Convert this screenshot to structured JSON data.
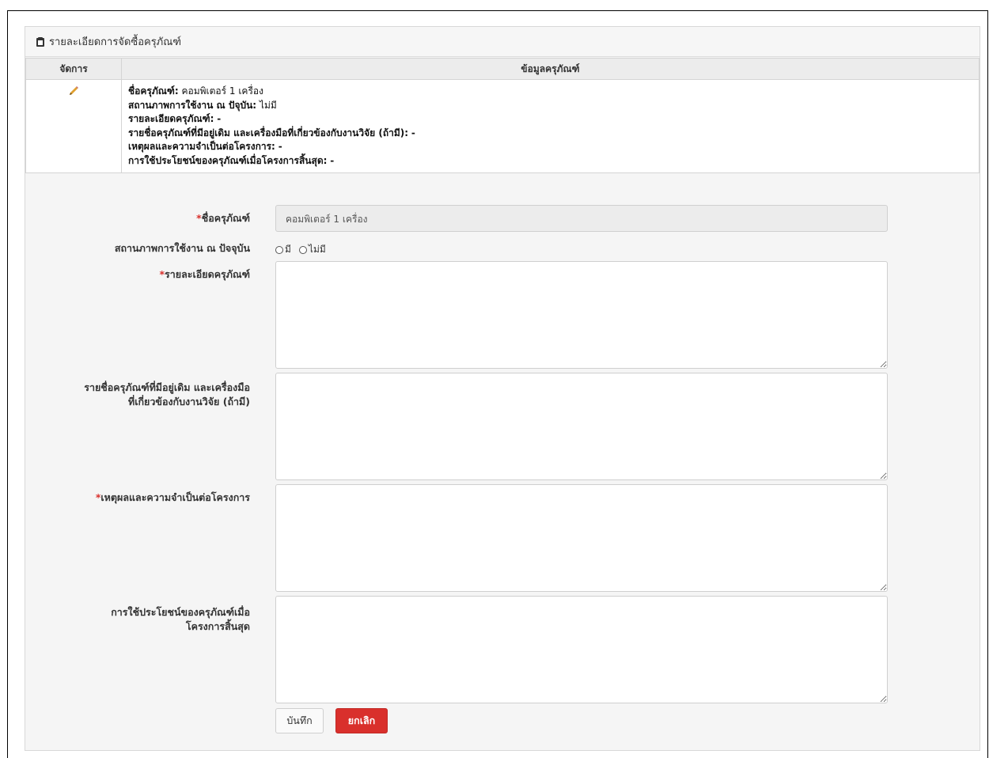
{
  "panel": {
    "title": "รายละเอียดการจัดซื้อครุภัณฑ์",
    "icon": "clipboard-icon"
  },
  "table": {
    "headers": {
      "action": "จัดการ",
      "info": "ข้อมูลครุภัณฑ์"
    },
    "row": {
      "edit_icon": "pencil-icon",
      "fields": [
        {
          "label": "ชื่อครุภัณฑ์:",
          "value": "คอมพิเตอร์ 1 เครื่อง"
        },
        {
          "label": "สถานภาพการใช้งาน ณ ปัจุบัน:",
          "value": "ไม่มี"
        },
        {
          "label": "รายละเอียดครุภัณฑ์:",
          "value": "-"
        },
        {
          "label": "รายชื่อครุภัณฑ์ที่มีอยู่เดิม และเครื่องมือที่เกี่ยวข้องกับงานวิจัย (ถ้ามี):",
          "value": "-"
        },
        {
          "label": "เหตุผลและความจำเป็นต่อโครงการ:",
          "value": "-"
        },
        {
          "label": "การใช้ประโยชน์ของครุภัณฑ์เมื่อโครงการสิ้นสุด:",
          "value": "-"
        }
      ]
    }
  },
  "form": {
    "required_mark": "*",
    "name": {
      "label": "ชื่อครุภัณฑ์",
      "value": "คอมพิเตอร์ 1 เครื่อง"
    },
    "status": {
      "label": "สถานภาพการใช้งาน ณ ปัจจุบัน",
      "options": [
        "มี",
        "ไม่มี"
      ]
    },
    "detail": {
      "label": "รายละเอียดครุภัณฑ์",
      "value": ""
    },
    "existing": {
      "label_line1": "รายชื่อครุภัณฑ์ที่มีอยู่เดิม และเครื่องมือ",
      "label_line2": "ที่เกี่ยวข้องกับงานวิจัย (ถ้ามี)",
      "value": ""
    },
    "reason": {
      "label": "เหตุผลและความจำเป็นต่อโครงการ",
      "value": ""
    },
    "usage": {
      "label_line1": "การใช้ประโยชน์ของครุภัณฑ์เมื่อ",
      "label_line2": "โครงการสิ้นสุด",
      "value": ""
    },
    "save_label": "บันทึก",
    "cancel_label": "ยกเลิก"
  },
  "colors": {
    "required": "#d9302c",
    "cancel_button": "#d9302c",
    "pencil": "#e0a030"
  }
}
